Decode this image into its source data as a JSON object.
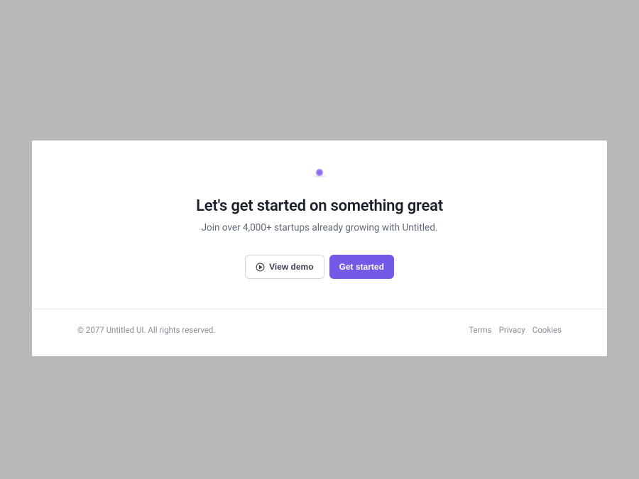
{
  "hero": {
    "heading": "Let's get started on something great",
    "subheading": "Join over 4,000+ startups already growing with Untitled."
  },
  "buttons": {
    "secondary_label": "View demo",
    "primary_label": "Get started"
  },
  "footer": {
    "copyright": "© 2077 Untitled UI. All rights reserved.",
    "links": {
      "terms": "Terms",
      "privacy": "Privacy",
      "cookies": "Cookies"
    }
  }
}
